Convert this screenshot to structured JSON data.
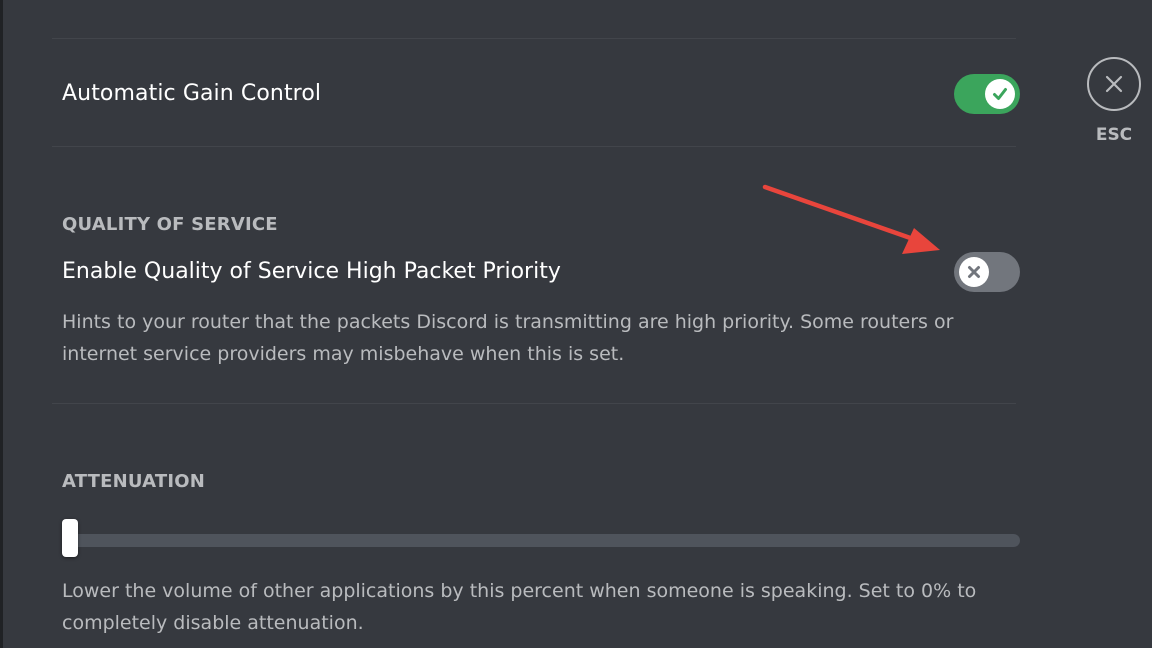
{
  "colors": {
    "background": "#36393f",
    "toggle_on": "#3ba55c",
    "toggle_off": "#72767d",
    "annotation_arrow": "#e8453c"
  },
  "voice_settings": {
    "automatic_gain_control": {
      "label": "Automatic Gain Control",
      "enabled": true,
      "toggle_icon": "check-icon"
    },
    "quality_of_service": {
      "section_title": "QUALITY OF SERVICE",
      "label": "Enable Quality of Service High Packet Priority",
      "enabled": false,
      "toggle_icon": "x-icon",
      "description": "Hints to your router that the packets Discord is transmitting are high priority. Some routers or internet service providers may misbehave when this is set."
    },
    "attenuation": {
      "section_title": "ATTENUATION",
      "value_percent": 0,
      "description": "Lower the volume of other applications by this percent when someone is speaking. Set to 0% to completely disable attenuation."
    }
  },
  "close": {
    "icon": "close-icon",
    "label": "ESC"
  },
  "annotation": {
    "type": "arrow",
    "points_to": "qos-toggle"
  }
}
